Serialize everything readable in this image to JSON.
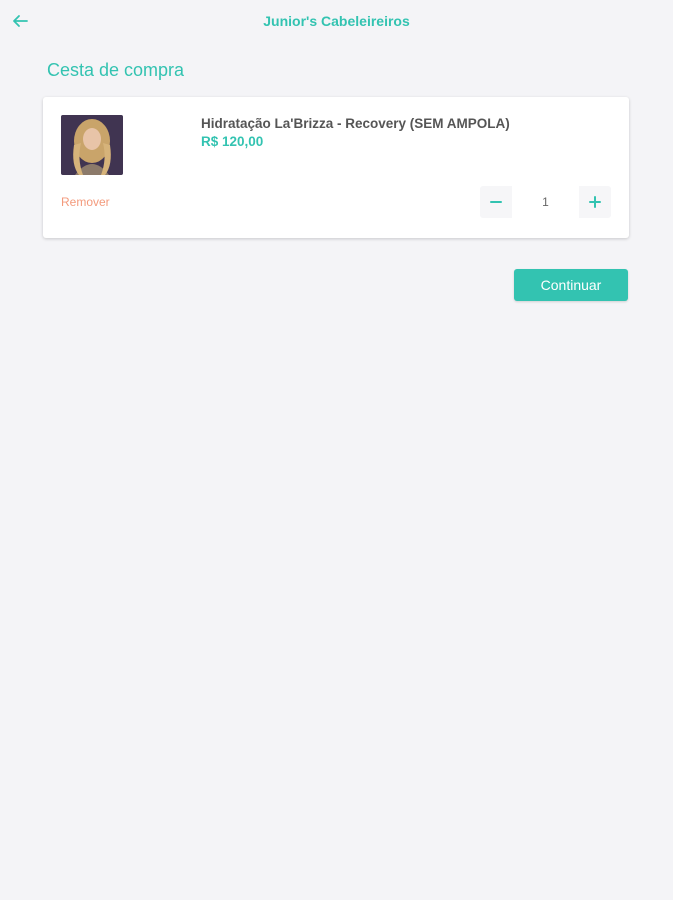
{
  "header": {
    "back_icon": "arrow-left-icon",
    "title": "Junior's Cabeleireiros"
  },
  "cart": {
    "title": "Cesta de compra",
    "items": [
      {
        "name": "Hidratação La'Brizza - Recovery (SEM AMPOLA)",
        "price": "R$ 120,00",
        "remove_label": "Remover",
        "quantity": "1",
        "image_icon": "product-photo"
      }
    ]
  },
  "actions": {
    "continue_label": "Continuar"
  },
  "colors": {
    "accent": "#33c3b1",
    "remove": "#f39a7c",
    "background": "#f4f4f7",
    "text": "#555555"
  }
}
